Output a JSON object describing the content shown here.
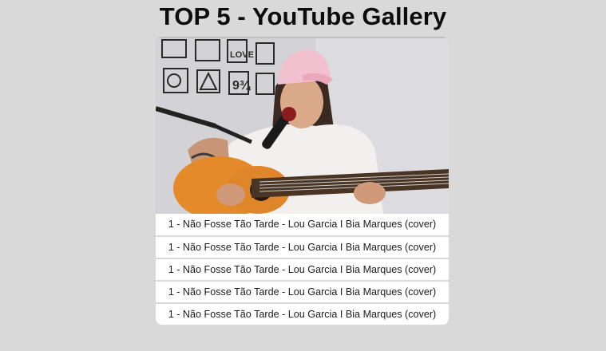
{
  "page": {
    "title": "TOP 5 - YouTube Gallery"
  },
  "gallery": {
    "video": {
      "thumbnail": "woman-singing-with-guitar-thumbnail"
    },
    "items": [
      {
        "label": "1 - Não Fosse Tão Tarde - Lou Garcia I Bia Marques (cover)"
      },
      {
        "label": "1 - Não Fosse Tão Tarde - Lou Garcia I Bia Marques (cover)"
      },
      {
        "label": "1 - Não Fosse Tão Tarde - Lou Garcia I Bia Marques (cover)"
      },
      {
        "label": "1 - Não Fosse Tão Tarde - Lou Garcia I Bia Marques (cover)"
      },
      {
        "label": "1 - Não Fosse Tão Tarde - Lou Garcia I Bia Marques (cover)"
      }
    ]
  },
  "colors": {
    "background": "#d9d9d9",
    "card": "#ffffff",
    "text": "#1c1c1c",
    "title": "#0c0c0c"
  }
}
